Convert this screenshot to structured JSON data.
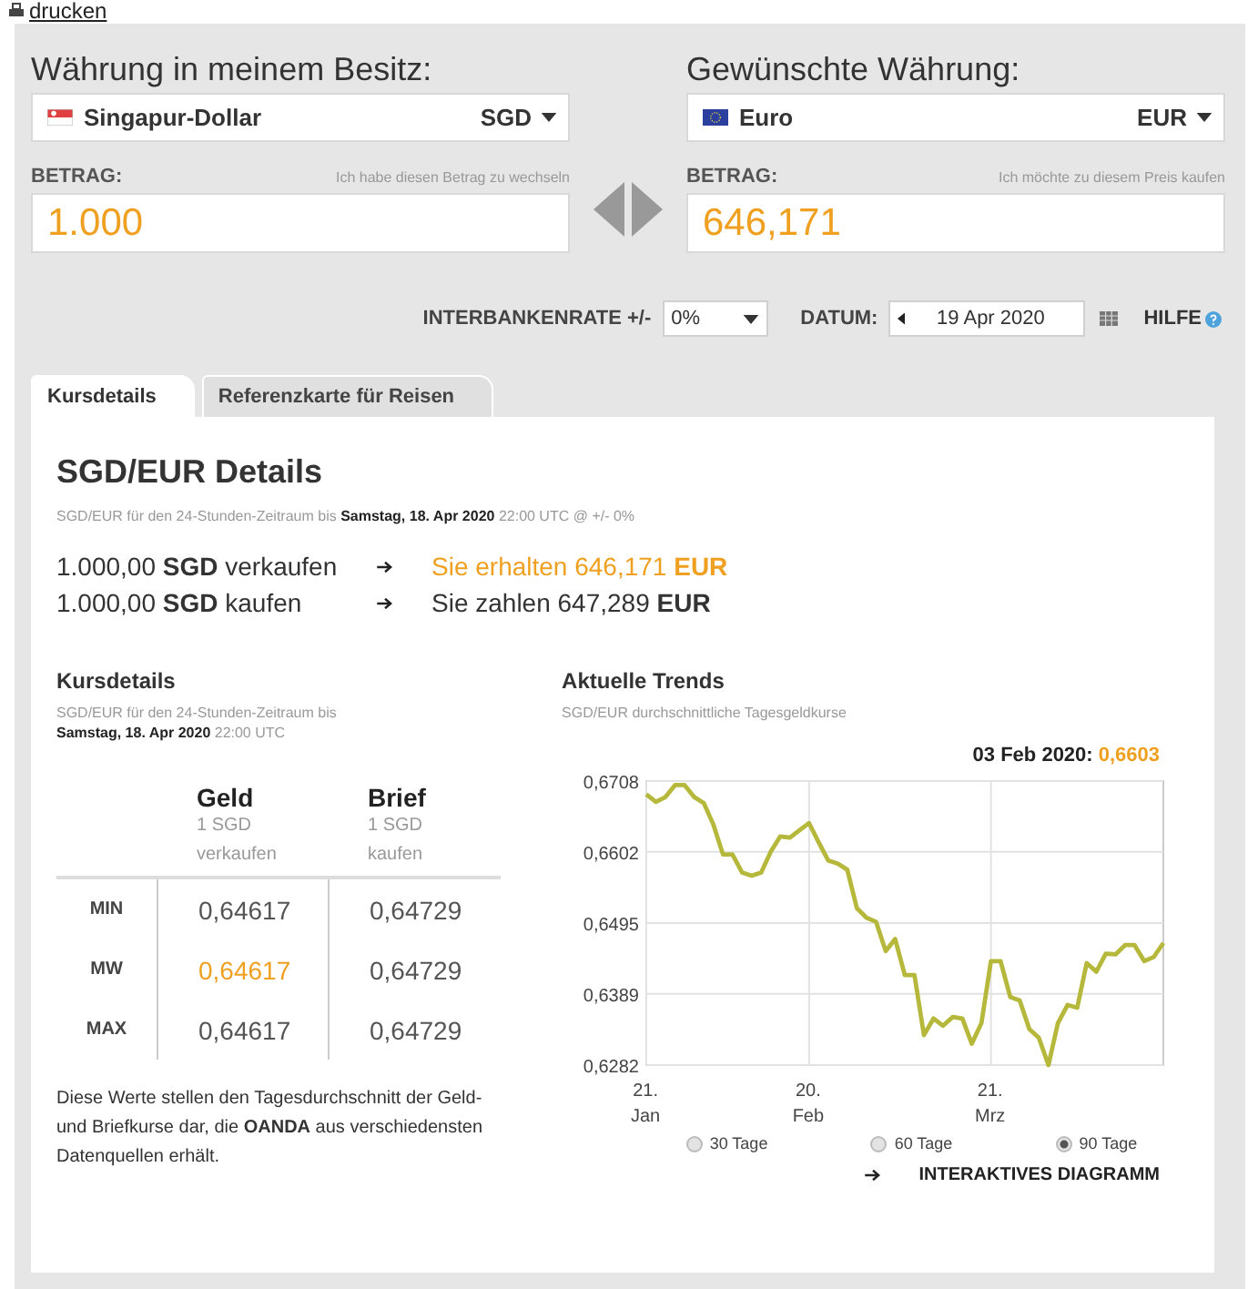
{
  "print_link": "drucken",
  "from": {
    "heading": "Währung in meinem Besitz:",
    "currency_name": "Singapur-Dollar",
    "currency_code": "SGD",
    "amount_label": "BETRAG:",
    "amount_hint": "Ich habe diesen Betrag zu wechseln",
    "amount": "1.000"
  },
  "to": {
    "heading": "Gewünschte Währung:",
    "currency_name": "Euro",
    "currency_code": "EUR",
    "amount_label": "BETRAG:",
    "amount_hint": "Ich möchte zu diesem Preis kaufen",
    "amount": "646,171"
  },
  "options": {
    "rate_label": "INTERBANKENRATE +/-",
    "rate_value": "0%",
    "date_label": "DATUM:",
    "date_value": "19 Apr 2020",
    "help": "HILFE"
  },
  "tabs": [
    {
      "label": "Kursdetails",
      "selected": true
    },
    {
      "label": "Referenzkarte für Reisen",
      "selected": false
    }
  ],
  "details": {
    "title": "SGD/EUR Details",
    "subtitle": "SGD/EUR für den 24-Stunden-Zeitraum bis **Samstag, 18. Apr 2020** 22:00 UTC @ +/- 0%",
    "conversions": [
      {
        "action": "1.000,00 **SGD** verkaufen",
        "result": "Sie erhalten 646,171 **EUR**",
        "highlighted": true
      },
      {
        "action": "1.000,00 **SGD** kaufen",
        "result": "Sie zahlen 647,289 **EUR**",
        "highlighted": false
      }
    ]
  },
  "rates": {
    "title": "Kursdetails",
    "subtitle": "SGD/EUR für den 24-Stunden-Zeitraum bis",
    "subtitle_date": "**Samstag, 18. Apr 2020** 22:00 UTC",
    "columns": [
      {
        "title": "Geld",
        "sub": "1 SGD verkaufen"
      },
      {
        "title": "Brief",
        "sub": "1 SGD kaufen"
      }
    ],
    "rows": [
      {
        "label": "MIN",
        "bid": "0,64617",
        "ask": "0,64729",
        "highlighted": false
      },
      {
        "label": "MW",
        "bid": "0,64617",
        "ask": "0,64729",
        "highlighted": true
      },
      {
        "label": "MAX",
        "bid": "0,64617",
        "ask": "0,64729",
        "highlighted": false
      }
    ],
    "note": "Diese Werte stellen den Tagesdurchschnitt der Geld- und Briefkurse dar, die **OANDA** aus verschiedensten Datenquellen erhält."
  },
  "trends": {
    "title": "Aktuelle Trends",
    "subtitle": "SGD/EUR durchschnittliche Tagesgeldkurse",
    "readout_date": "03 Feb 2020:",
    "readout_value": "0,6603",
    "chart_data": {
      "type": "line",
      "categories": [
        "21. Jan",
        null,
        null,
        null,
        null,
        null,
        null,
        null,
        null,
        null,
        null,
        null,
        null,
        null,
        null,
        null,
        null,
        "20. Feb",
        null,
        null,
        null,
        null,
        null,
        null,
        null,
        null,
        null,
        null,
        null,
        null,
        null,
        null,
        null,
        null,
        null,
        null,
        "21. Mrz",
        null,
        null,
        null,
        null,
        null,
        null,
        null,
        null,
        null,
        null,
        null,
        null,
        null,
        null,
        null,
        null,
        null,
        null
      ],
      "series": [
        {
          "color": "#b5b83a",
          "values": [
            0.6688,
            0.6677,
            0.6684,
            0.6702,
            0.6702,
            0.6684,
            0.6675,
            0.6643,
            0.6598,
            0.6598,
            0.6571,
            0.6566,
            0.6571,
            0.6602,
            0.6625,
            0.6623,
            0.6634,
            0.6645,
            0.6616,
            0.6589,
            0.6584,
            0.6575,
            0.6517,
            0.6503,
            0.6497,
            0.6453,
            0.6471,
            0.6417,
            0.6417,
            0.6327,
            0.6352,
            0.6341,
            0.6354,
            0.6352,
            0.6314,
            0.6345,
            0.6438,
            0.6438,
            0.6384,
            0.6379,
            0.6336,
            0.6323,
            0.6282,
            0.6345,
            0.6372,
            0.6368,
            0.6435,
            0.6422,
            0.6449,
            0.6448,
            0.6462,
            0.6462,
            0.6438,
            0.6444,
            0.6465
          ]
        }
      ],
      "ylim": [
        0.6282,
        0.6708
      ],
      "grid": true,
      "yticks": [
        {
          "value": 0.6282,
          "label": "0,6282"
        },
        {
          "value": 0.6389,
          "label": "0,6389"
        },
        {
          "value": 0.6495,
          "label": "0,6495"
        },
        {
          "value": 0.6602,
          "label": "0,6602"
        },
        {
          "value": 0.6708,
          "label": "0,6708"
        }
      ]
    },
    "ranges": [
      {
        "label": "30 Tage",
        "selected": false
      },
      {
        "label": "60 Tage",
        "selected": false
      },
      {
        "label": "90 Tage",
        "selected": true
      }
    ],
    "link": "INTERAKTIVES DIAGRAMM"
  }
}
